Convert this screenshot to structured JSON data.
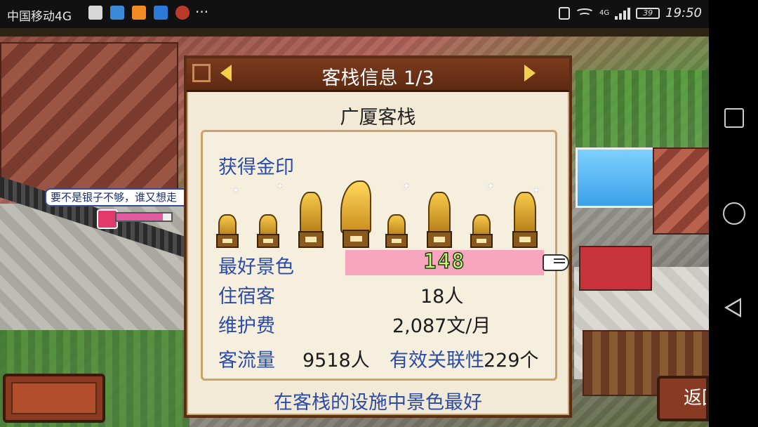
{
  "status_bar": {
    "carrier": "中国移动4G",
    "signal_type": "4G",
    "battery": "39",
    "time": "19:50",
    "notification_icons": [
      "a-icon",
      "browser-icon",
      "orange-app-icon",
      "video-icon",
      "game-icon"
    ]
  },
  "game": {
    "speech_bubble": "要不是银子不够，谁又想走",
    "hearts_meter": 0.85,
    "return_button": "返回"
  },
  "dialog": {
    "title": "客栈信息 1/3",
    "inn_name": "广厦客栈",
    "gold_seal_label": "获得金印",
    "best_scenery_label": "最好景色",
    "best_scenery_value": "148",
    "guests_label": "住宿客",
    "guests_value": "18人",
    "maintenance_label": "维护费",
    "maintenance_value": "2,087文/月",
    "traffic_label": "客流量",
    "traffic_value": "9518人",
    "linkage_label": "有效关联性",
    "linkage_value": "229个",
    "footer_message": "在客栈的设施中景色最好"
  },
  "colors": {
    "label_blue": "#2b4ca6",
    "header_brown": "#6b3219",
    "panel_bg": "#f2ead6",
    "highlight_pink": "#f7a6bd",
    "arrow_yellow": "#f3d24a"
  }
}
